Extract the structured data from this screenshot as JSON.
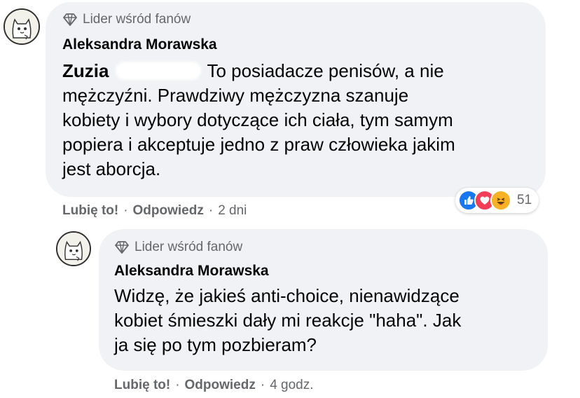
{
  "comment1": {
    "badge": "Lider wśród fanów",
    "author": "Aleksandra Morawska",
    "mention": "Zuzia",
    "text_line1": "To posiadacze penisów, a nie",
    "text_line2": "mężczyźni. Prawdziwy mężczyzna szanuje",
    "text_line3": "kobiety i wybory dotyczące ich ciała, tym samym",
    "text_line4": "popiera i akceptuje jedno z praw człowieka jakim",
    "text_line5": "jest aborcja.",
    "like_label": "Lubię to!",
    "reply_label": "Odpowiedz",
    "time": "2 dni",
    "reaction_count": "51",
    "reaction_icons": [
      "like-icon",
      "love-icon",
      "haha-icon"
    ]
  },
  "comment2": {
    "badge": "Lider wśród fanów",
    "author": "Aleksandra Morawska",
    "text_line1": "Widzę, że jakieś anti-choice, nienawidzące",
    "text_line2": "kobiet śmieszki dały mi reakcje \"haha\". Jak",
    "text_line3": "ja się po tym pozbieram?",
    "like_label": "Lubię to!",
    "reply_label": "Odpowiedz",
    "time": "4 godz."
  },
  "separator": "·",
  "colors": {
    "bubble": "#f0f2f5",
    "secondary_text": "#65676b",
    "like_blue": "#1877f2",
    "love_red": "#f33e58",
    "haha_yellow": "#f7b125"
  }
}
